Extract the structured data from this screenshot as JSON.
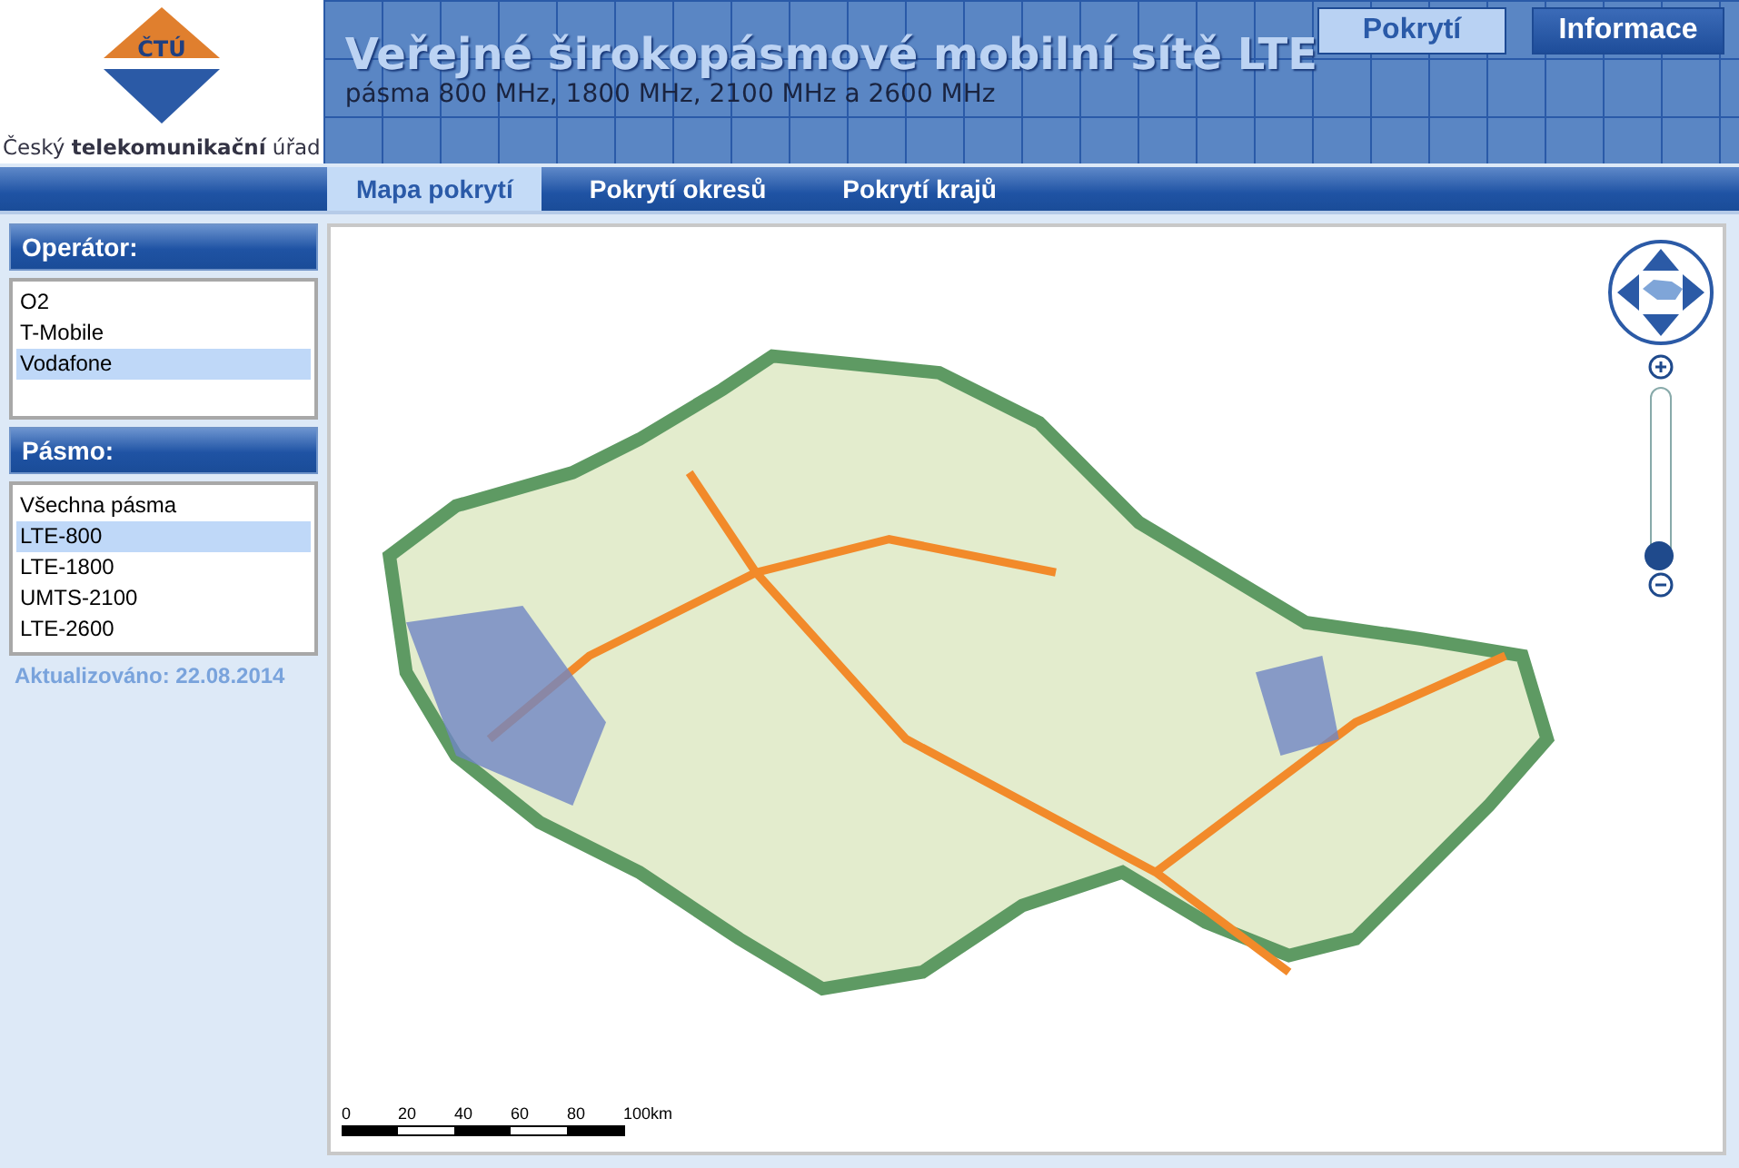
{
  "header": {
    "logo_text": "Český **telekomunikační** úřad",
    "logo_mark": "ČTÚ",
    "title": "Veřejné širokopásmové mobilní sítě LTE",
    "subtitle": "pásma 800 MHz, 1800 MHz, 2100 MHz a 2600 MHz",
    "buttons": [
      {
        "label": "Pokrytí",
        "selected": true
      },
      {
        "label": "Informace",
        "selected": false
      }
    ]
  },
  "tabs": [
    {
      "label": "Mapa pokrytí",
      "selected": true
    },
    {
      "label": "Pokrytí okresů",
      "selected": false
    },
    {
      "label": "Pokrytí krajů",
      "selected": false
    }
  ],
  "sidebar": {
    "operator": {
      "title": "Operátor:",
      "items": [
        {
          "label": "O2",
          "selected": false
        },
        {
          "label": "T-Mobile",
          "selected": false
        },
        {
          "label": "Vodafone",
          "selected": true
        }
      ]
    },
    "band": {
      "title": "Pásmo:",
      "items": [
        {
          "label": "Všechna pásma",
          "selected": false
        },
        {
          "label": "LTE-800",
          "selected": true
        },
        {
          "label": "LTE-1800",
          "selected": false
        },
        {
          "label": "UMTS-2100",
          "selected": false
        },
        {
          "label": "LTE-2600",
          "selected": false
        }
      ]
    },
    "updated": "Aktualizováno:  22.08.2014"
  },
  "map": {
    "zoom": {
      "level": 0
    },
    "scale_labels": [
      "0",
      "20",
      "40",
      "60",
      "80",
      "100km"
    ]
  }
}
